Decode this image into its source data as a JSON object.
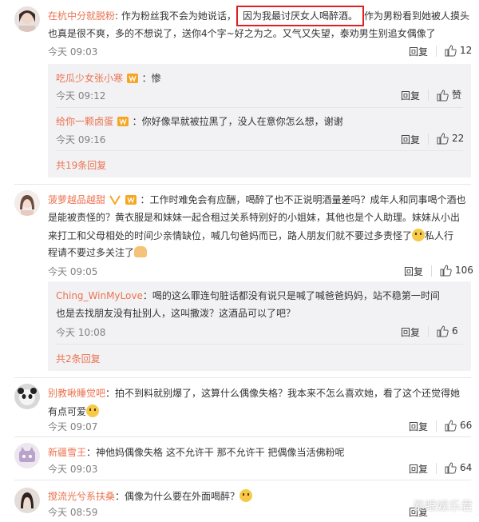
{
  "comments": [
    {
      "user": "在杭中分就脱粉",
      "lines": [
        ":  作为粉丝我不会为她说话，",
        "因为我最讨厌女人喝醉酒。",
        "作为男粉看到她被人摸头",
        "也真是很不爽，多的不想说了，送你4个字~好之为之。又气又失望，泰劝男生别追女偶像了"
      ],
      "time": "今天 09:03",
      "reply": "回复",
      "likes": "12",
      "replies": [
        {
          "user": "吃瓜少女张小寒",
          "text": "：惨",
          "time": "今天 09:12",
          "reply": "回复",
          "likes": "赞"
        },
        {
          "user": "给你一颗卤蛋",
          "text": "：你好像早就被拉黑了，没人在意你怎么想，谢谢",
          "time": "今天 09:16",
          "reply": "回复",
          "likes": "22"
        }
      ],
      "more": "共19条回复"
    },
    {
      "user": "菠萝越品越甜",
      "lines": [
        "：工作时难免会有应酬，喝醉了也不正说明酒量差吗？成年人和同事喝个酒也",
        "是能被责怪的？黄衣服是和妹妹一起合租过关系特别好的小姐妹，其他也是个人助理。妹妹从小出",
        "来打工和父母相处的时间少亲情缺位，喊几句爸妈而已，路人朋友们就不要过多责怪了",
        "私人行",
        "程请不要过多关注了"
      ],
      "time": "今天 09:05",
      "reply": "回复",
      "likes": "106",
      "replies": [
        {
          "user": "Ching_WinMyLove",
          "lines": [
            "：喝的这么罪连句脏话都没有说只是喊了喊爸爸妈妈，站不稳第一时间",
            "也是去找朋友没有扯别人，这叫撒泼？这酒品可以了吧？"
          ],
          "time": "今天 10:08",
          "reply": "回复",
          "likes": "6"
        }
      ],
      "more": "共2条回复"
    },
    {
      "user": "别教啾睡觉吧",
      "lines": [
        "：拍不到料就别爆了，这算什么偶像失格？我本来不怎么喜欢她，看了这个还觉得她",
        "有点可爱"
      ],
      "time": "今天 09:07",
      "reply": "回复",
      "likes": "66"
    },
    {
      "user": "新疆雪王",
      "lines": [
        "：神他妈偶像失格 这不允许干 那不允许干 把偶像当活佛粉呢"
      ],
      "time": "今天 09:03",
      "reply": "回复",
      "likes": "64"
    },
    {
      "user": "搅流光兮系扶桑",
      "lines": [
        "：偶像为什么要在外面喝醉？"
      ],
      "time": "今天 08:59",
      "reply": "回复"
    }
  ],
  "watermark": "暴眼娱乐君",
  "colors": {
    "username": "#eb7350",
    "highlight_box": "#e02020",
    "sub_bg": "#f2f2f5"
  },
  "icons": [
    "thumb-up-icon",
    "vip-badge-icon",
    "emoji-icon"
  ]
}
